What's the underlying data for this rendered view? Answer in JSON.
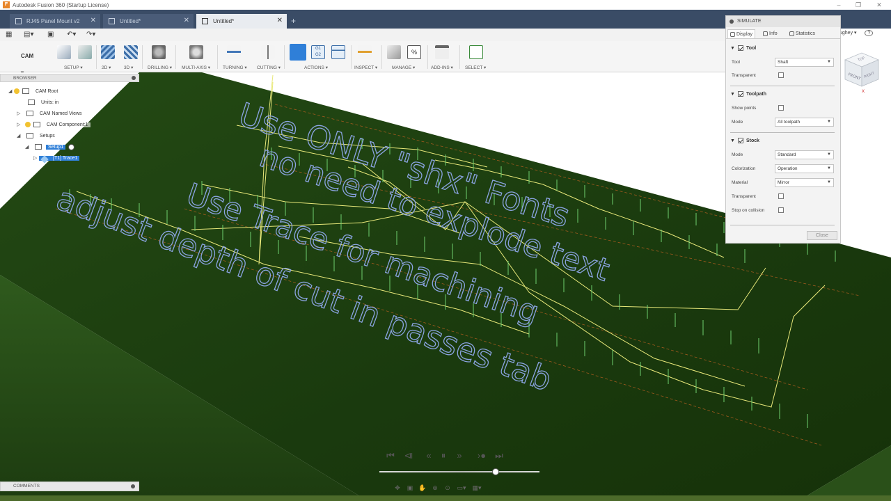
{
  "window": {
    "title": "Autodesk Fusion 360 (Startup License)",
    "app_icon_letter": "F",
    "controls": [
      "–",
      "❐",
      "✕"
    ]
  },
  "doc_tabs": [
    {
      "label": "RJ45 Panel Mount v2",
      "active": false
    },
    {
      "label": "Untitled*",
      "active": false
    },
    {
      "label": "Untitled*",
      "active": true
    }
  ],
  "user": {
    "name_partial": "ughey ▾",
    "help": "?"
  },
  "workspace": {
    "label": "CAM ▾"
  },
  "ribbon_groups": [
    {
      "label": "SETUP ▾"
    },
    {
      "label": "2D ▾"
    },
    {
      "label": "3D ▾"
    },
    {
      "label": "DRILLING ▾"
    },
    {
      "label": "MULTI-AXIS ▾"
    },
    {
      "label": "TURNING ▾"
    },
    {
      "label": "CUTTING ▾"
    },
    {
      "label": "ACTIONS ▾"
    },
    {
      "label": "INSPECT ▾"
    },
    {
      "label": "MANAGE ▾"
    },
    {
      "label": "ADD-INS ▾"
    },
    {
      "label": "SELECT ▾"
    }
  ],
  "actions_icon_text": "G1\nG2",
  "manage_icon_text": "%",
  "browser": {
    "title": "BROWSER",
    "items": [
      {
        "label": "CAM Root",
        "selected": false
      },
      {
        "label": "Units: in",
        "selected": false
      },
      {
        "label": "CAM Named Views",
        "selected": false
      },
      {
        "label": "CAM Component:1",
        "selected": false
      },
      {
        "label": "Setups",
        "selected": false
      },
      {
        "label": "Setup1",
        "selected": true
      },
      {
        "label": "[T1] Trace1",
        "selected": true
      }
    ]
  },
  "simulate": {
    "title": "SIMULATE",
    "tabs": [
      "Display",
      "Info",
      "Statistics"
    ],
    "sections": {
      "tool": {
        "title": "Tool",
        "checked": true
      },
      "toolpath": {
        "title": "Toolpath",
        "checked": true
      },
      "stock": {
        "title": "Stock",
        "checked": true
      }
    },
    "props": {
      "tool_label": "Tool",
      "tool_value": "Shaft",
      "transparent_label": "Transparent",
      "show_points_label": "Show points",
      "mode_label": "Mode",
      "toolpath_mode_value": "All toolpath",
      "stock_mode_value": "Standard",
      "colorization_label": "Colorization",
      "colorization_value": "Operation",
      "material_label": "Material",
      "material_value": "Mirror",
      "stock_transparent_label": "Transparent",
      "stop_on_collision_label": "Stop on collision"
    },
    "close_label": "Close"
  },
  "viewcube": {
    "face_front": "FRONT",
    "face_top": "TOP",
    "face_right": "RIGHT",
    "axis_x": "X"
  },
  "engraved_text": [
    "Use ONLY \"shx\" Fonts",
    "no need to explode text",
    "Use Trace for machining",
    "adjust depth of cut in passes tab"
  ],
  "comments": {
    "title": "COMMENTS"
  },
  "colors": {
    "tabbar": "#3a4c66",
    "stock_top": "#1e3d12",
    "stock_side": "#2b4d1a",
    "toolpath": "#e8e87a",
    "plunge": "#6fd06f",
    "text": "#8aa3e0",
    "selection": "#2f7fd8"
  }
}
